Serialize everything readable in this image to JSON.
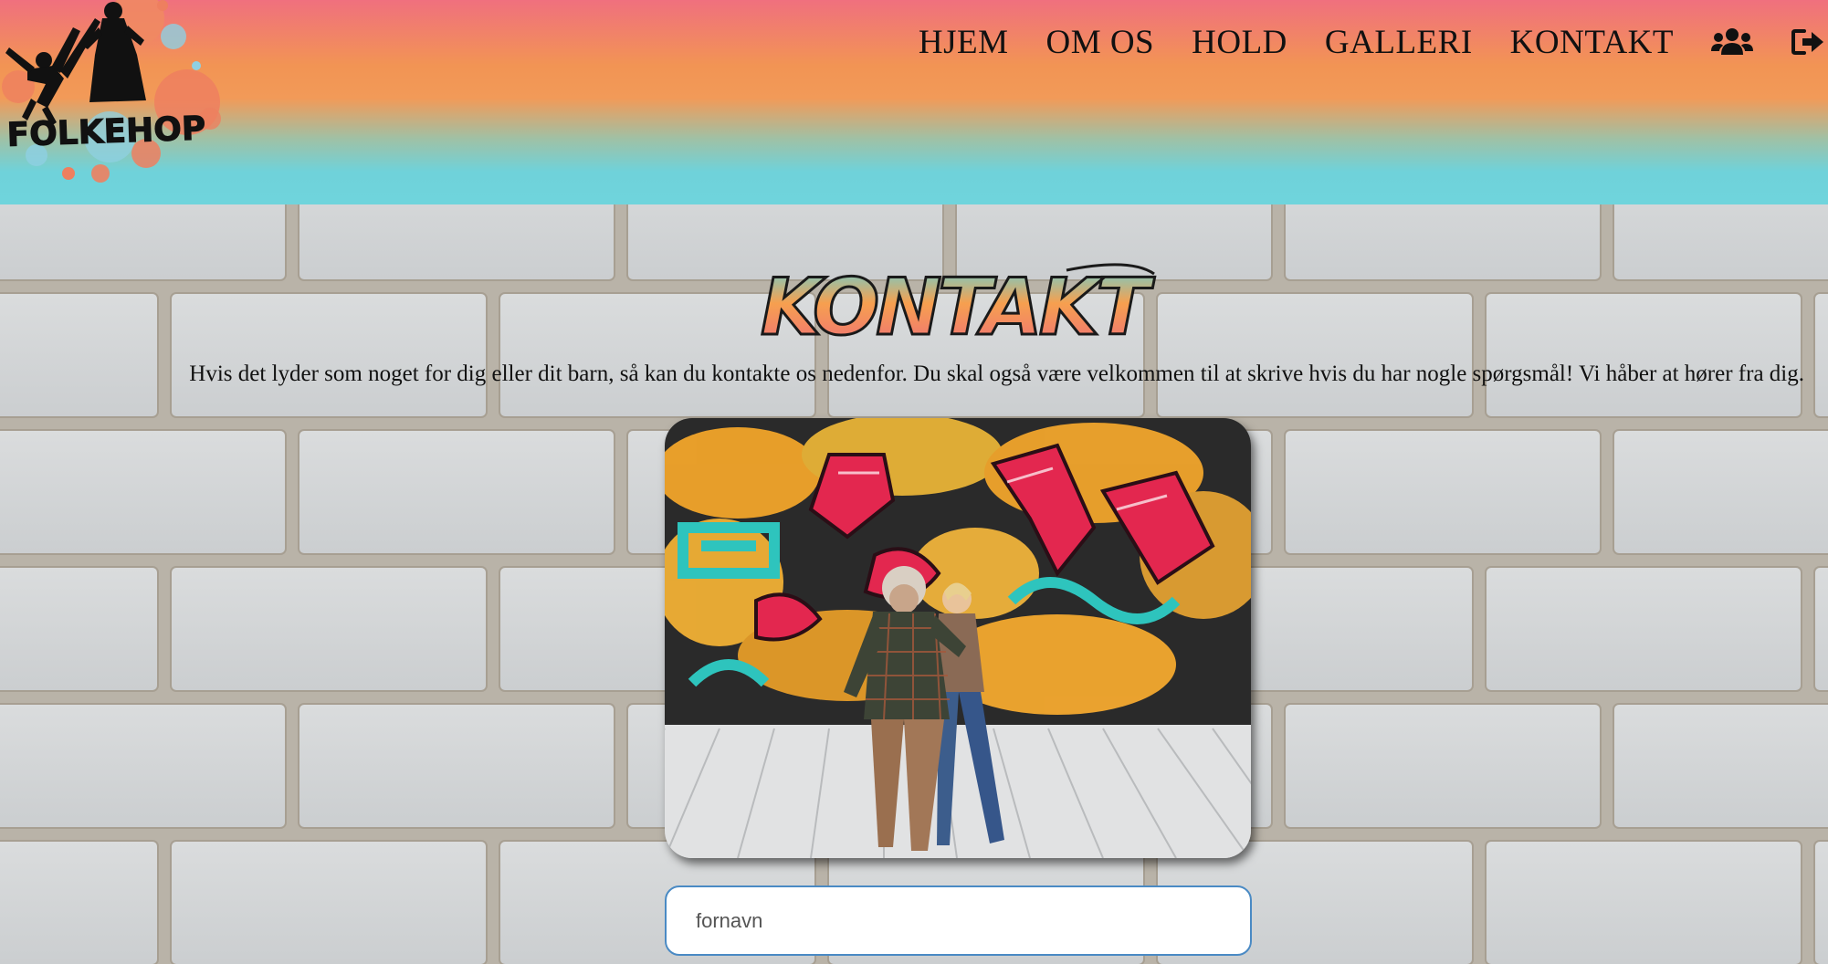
{
  "brand": {
    "logo_text": "FOLKEHOP",
    "colors": {
      "header_top": "#f0707e",
      "header_mid": "#f29454",
      "header_bottom": "#6fd4dc",
      "wall": "#cfd2d4",
      "input_border": "#4a8ac4"
    }
  },
  "nav": {
    "items": [
      {
        "label": "HJEM"
      },
      {
        "label": "OM OS"
      },
      {
        "label": "HOLD"
      },
      {
        "label": "GALLERI"
      },
      {
        "label": "KONTAKT"
      }
    ],
    "icons": [
      "users-icon",
      "sign-out-icon"
    ]
  },
  "page": {
    "heading": "KONTAKT",
    "intro": "Hvis det lyder som noget for dig eller dit barn, så kan du kontakte os nedenfor. Du skal også være velkommen til at skrive hvis du har nogle spørgsmål! Vi håber at hører fra dig."
  },
  "form": {
    "first_name": {
      "placeholder": "fornavn",
      "value": ""
    }
  }
}
